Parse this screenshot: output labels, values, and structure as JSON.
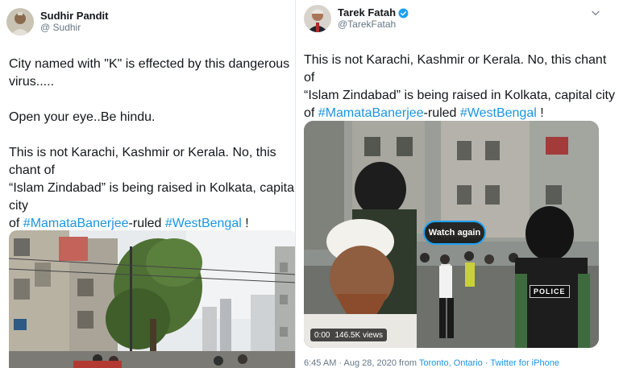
{
  "left_tweet": {
    "author": {
      "name": "Sudhir Pandit",
      "handle": "@ Sudhir"
    },
    "text_line1": "City named with \"K\" is effected by this dangerous",
    "text_line2": "virus.....",
    "text_line3": "Open your eye..Be hindu.",
    "text_line4": "This is not Karachi, Kashmir or Kerala. No, this chant of",
    "text_line5": "“Islam Zindabad” is being raised in Kolkata, capital city",
    "text_line6_pre": "of ",
    "hashtag1": "#MamataBanerjee",
    "text_line6_mid": "-ruled ",
    "hashtag2": "#WestBengal",
    "text_line6_post": " !",
    "media": {
      "signs": [
        "B",
        "SHOP"
      ]
    }
  },
  "right_tweet": {
    "author": {
      "name": "Tarek Fatah",
      "handle": "@TarekFatah"
    },
    "text_line1": "This is not Karachi, Kashmir or Kerala. No, this chant of",
    "text_line2": "“Islam Zindabad” is being raised in Kolkata, capital city",
    "text_line3_pre": "of ",
    "hashtag1": "#MamataBanerjee",
    "text_line3_mid": "-ruled ",
    "hashtag2": "#WestBengal",
    "text_line3_post": " !",
    "video": {
      "watch_again": "Watch again",
      "time": "0:00",
      "views": "146.5K views",
      "police_label": "POLICE"
    },
    "meta": {
      "time": "6:45 AM · Aug 28, 2020 from ",
      "location": "Toronto, Ontario",
      "sep": " · ",
      "client": "Twitter for iPhone"
    }
  },
  "colors": {
    "link": "#1b95e0",
    "verified": "#1da1f2",
    "muted": "#657786"
  }
}
